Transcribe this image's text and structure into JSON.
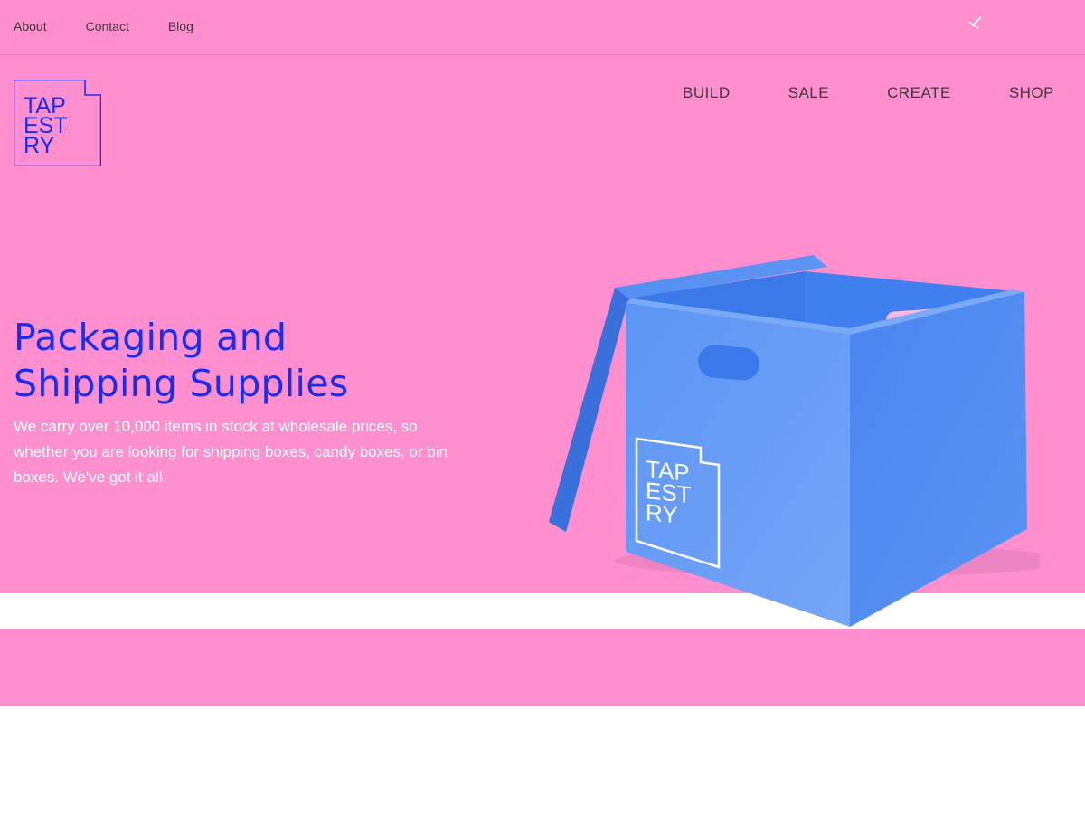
{
  "top_links": {
    "about": "About",
    "contact": "Contact",
    "blog": "Blog"
  },
  "top_icon": "checkmark-bird-icon",
  "logo": {
    "lines": [
      "TAP",
      "EST",
      "RY"
    ]
  },
  "main_nav": {
    "build": "BUILD",
    "sale": "SALE",
    "create": "CREATE",
    "shop": "SHOP"
  },
  "hero": {
    "headline_line1": "Packaging and",
    "headline_line2": "Shipping Supplies",
    "description": "We carry over 10,000 items in stock at wholesale prices, so whether you are looking for shipping boxes, candy boxes, or bin boxes. We've got it all."
  },
  "product_image": {
    "box_logo_lines": [
      "TAP",
      "EST",
      "RY"
    ]
  },
  "colors": {
    "background_pink": "#ff8fcf",
    "brand_blue": "#1a2cf2",
    "box_blue": "#5b93f2",
    "nav_text": "#3a3a3a"
  }
}
